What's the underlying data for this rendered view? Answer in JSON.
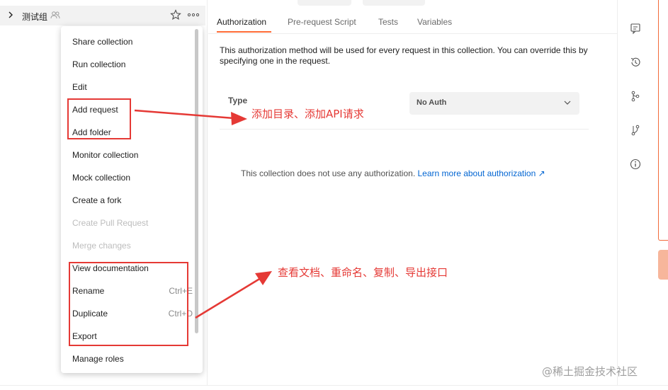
{
  "sidebar": {
    "collection_name": "测试组",
    "icons": {
      "expand": "chevron-right-icon",
      "shared": "people-icon",
      "favorite": "star-icon",
      "more": "more-horizontal-icon"
    }
  },
  "context_menu": {
    "items": [
      {
        "label": "Share collection",
        "shortcut": "",
        "disabled": false
      },
      {
        "label": "Run collection",
        "shortcut": "",
        "disabled": false
      },
      {
        "label": "Edit",
        "shortcut": "",
        "disabled": false
      },
      {
        "label": "Add request",
        "shortcut": "",
        "disabled": false
      },
      {
        "label": "Add folder",
        "shortcut": "",
        "disabled": false
      },
      {
        "label": "Monitor collection",
        "shortcut": "",
        "disabled": false
      },
      {
        "label": "Mock collection",
        "shortcut": "",
        "disabled": false
      },
      {
        "label": "Create a fork",
        "shortcut": "",
        "disabled": false
      },
      {
        "label": "Create Pull Request",
        "shortcut": "",
        "disabled": true
      },
      {
        "label": "Merge changes",
        "shortcut": "",
        "disabled": true
      },
      {
        "label": "View documentation",
        "shortcut": "",
        "disabled": false
      },
      {
        "label": "Rename",
        "shortcut": "Ctrl+E",
        "disabled": false
      },
      {
        "label": "Duplicate",
        "shortcut": "Ctrl+D",
        "disabled": false
      },
      {
        "label": "Export",
        "shortcut": "",
        "disabled": false
      },
      {
        "label": "Manage roles",
        "shortcut": "",
        "disabled": false
      }
    ]
  },
  "tabs": [
    {
      "label": "Authorization",
      "active": true
    },
    {
      "label": "Pre-request Script",
      "active": false
    },
    {
      "label": "Tests",
      "active": false
    },
    {
      "label": "Variables",
      "active": false
    }
  ],
  "auth": {
    "description": "This authorization method will be used for every request in this collection. You can override this by specifying one in the request.",
    "type_label": "Type",
    "type_value": "No Auth",
    "no_auth_text": "This collection does not use any authorization.",
    "learn_more": "Learn more about authorization ↗"
  },
  "annotations": {
    "add": "添加目录、添加API请求",
    "docs": "查看文档、重命名、复制、导出接口",
    "color": "#e53935"
  },
  "right_rail": {
    "icons": [
      "comment-icon",
      "history-icon",
      "fork-icon",
      "pull-request-icon",
      "info-icon"
    ]
  },
  "watermark": "@稀土掘金技术社区",
  "colors": {
    "accent": "#ff6c37",
    "link": "#0265d2",
    "highlight": "#e53935"
  }
}
